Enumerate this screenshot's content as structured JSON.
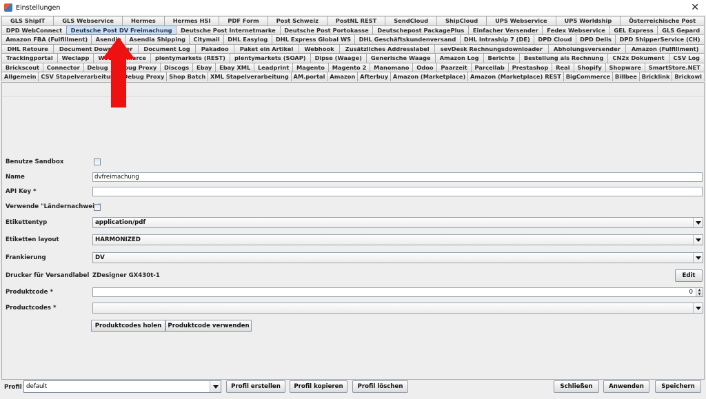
{
  "window": {
    "title": "Einstellungen",
    "close_glyph": "✕"
  },
  "tab_rows": [
    [
      "GLS ShipIT",
      "GLS Webservice",
      "Hermes",
      "Hermes HSI",
      "PDF Form",
      "Post Schweiz",
      "PostNL REST",
      "SendCloud",
      "ShipCloud",
      "UPS Webservice",
      "UPS Worldship",
      "Österreichische Post"
    ],
    [
      "DPD WebConnect",
      "Deutsche Post DV Freimachung",
      "Deutsche Post Internetmarke",
      "Deutsche Post Portokasse",
      "Deutschepost PackagePlus",
      "Einfacher Versender",
      "Fedex Webservice",
      "GEL Express",
      "GLS Gepard"
    ],
    [
      "Amazon FBA (Fulfillment)",
      "Asendia",
      "Asendia Shipping",
      "Citymail",
      "DHL Easylog",
      "DHL Express Global WS",
      "DHL Geschäftskundenversand",
      "DHL Intraship 7 (DE)",
      "DPD Cloud",
      "DPD Delis",
      "DPD ShipperService (CH)"
    ],
    [
      "DHL Retoure",
      "Document Downloader",
      "Document Log",
      "Pakadoo",
      "Paket ein Artikel",
      "Webhook",
      "Zusätzliches Addresslabel",
      "sevDesk Rechnungsdownloader",
      "Abholungsversender",
      "Amazon (Fulfillment)"
    ],
    [
      "Trackingportal",
      "Weclapp",
      "WooCommerce",
      "plentymarkets (REST)",
      "plentymarkets (SOAP)",
      "Dipse (Waage)",
      "Generische Waage",
      "Amazon Log",
      "Berichte",
      "Bestellung als Rechnung",
      "CN2x Dokument",
      "CSV Log"
    ],
    [
      "Brickscout",
      "Connector",
      "Debug",
      "Debug Proxy",
      "Discogs",
      "Ebay",
      "Ebay XML",
      "Leadprint",
      "Magento",
      "Magento 2",
      "Manomano",
      "Odoo",
      "Paarzeit",
      "Parcellab",
      "Prestashop",
      "Real",
      "Shopify",
      "Shopware",
      "SmartStore.NET"
    ],
    [
      "Allgemein",
      "CSV Stapelverarbeitung",
      "Debug Proxy",
      "Shop Batch",
      "XML Stapelverarbeitung",
      "AM.portal",
      "Amazon",
      "Afterbuy",
      "Amazon (Marketplace)",
      "Amazon (Marketplace) REST",
      "BigCommerce",
      "Billbee",
      "Bricklink",
      "Brickowl"
    ]
  ],
  "selected_tab": "Deutsche Post DV Freimachung",
  "form": {
    "sandbox_label": "Benutze Sandbox",
    "name_label": "Name",
    "name_value": "dvfreimachung",
    "apikey_label": "API Key *",
    "apikey_value": "",
    "laendernachweis_label": "Verwende \"Ländernachweis\"",
    "etikettentyp_label": "Etikettentyp",
    "etikettentyp_value": "application/pdf",
    "etiketten_layout_label": "Etiketten layout",
    "etiketten_layout_value": "HARMONIZED",
    "frankierung_label": "Frankierung",
    "frankierung_value": "DV",
    "drucker_label": "Drucker für Versandlabel",
    "drucker_value": "ZDesigner GX430t-1",
    "edit_button": "Edit",
    "produktcode_label": "Produktcode *",
    "produktcode_value": "0",
    "productcodes_label": "Productcodes *",
    "productcodes_value": "",
    "holen_button": "Produktcodes holen",
    "verwenden_button": "Produktcode verwenden"
  },
  "bottom": {
    "profil_label": "Profil",
    "profil_value": "default",
    "erstellen_button": "Profil erstellen",
    "kopieren_button": "Profil kopieren",
    "loeschen_button": "Profil löschen",
    "schliessen_button": "Schließen",
    "anwenden_button": "Anwenden",
    "speichern_button": "Speichern"
  },
  "colors": {
    "annotation_arrow": "#ee1111",
    "selected_tab": "#cfe2f6"
  }
}
